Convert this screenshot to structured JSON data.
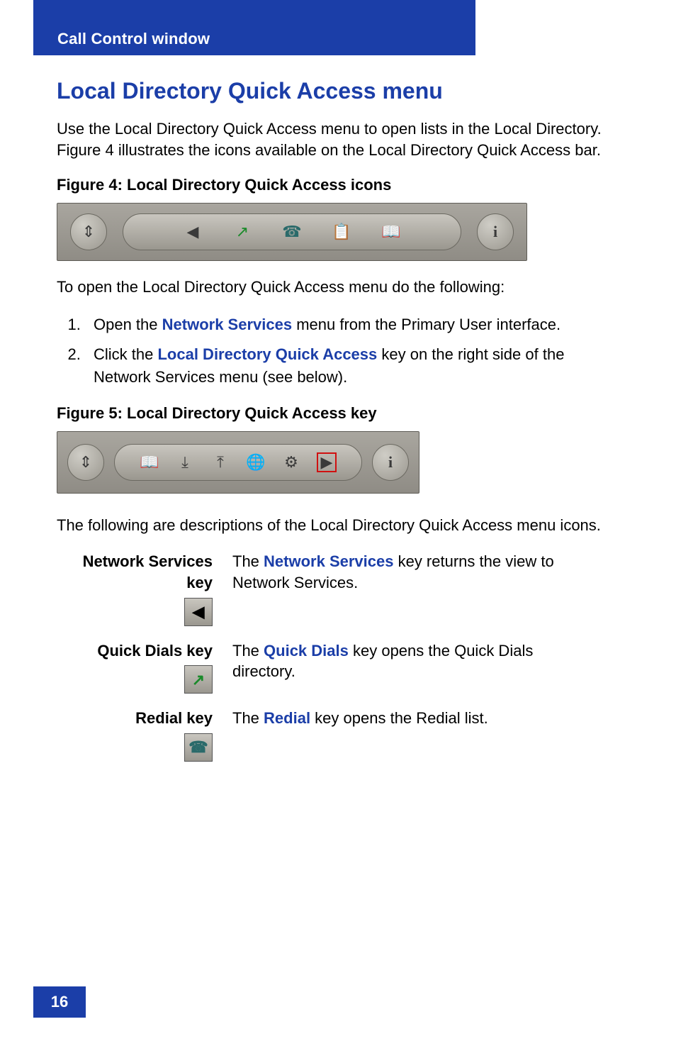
{
  "header": {
    "title": "Call Control window"
  },
  "h1": "Local Directory Quick Access menu",
  "intro": "Use the Local Directory Quick Access menu to open lists in the Local Directory. Figure 4 illustrates the icons available on the Local Directory Quick Access bar.",
  "fig4_caption": "Figure 4: Local Directory Quick Access icons",
  "fig4_icons": {
    "updown": "⇕",
    "back": "◀",
    "quickdials": "↗",
    "redial": "☎",
    "callers": "📋",
    "book": "📖",
    "info": "i"
  },
  "steps_intro": "To open the Local Directory Quick Access menu do the following:",
  "steps": [
    {
      "pre": "Open the ",
      "link": "Network Services",
      "post": " menu from the Primary User interface."
    },
    {
      "pre": "Click the ",
      "link": "Local Directory Quick Access",
      "post": " key on the right side of the Network Services menu (see below)."
    }
  ],
  "fig5_caption": "Figure 5: Local Directory Quick Access key",
  "fig5_icons": {
    "updown": "⇕",
    "book": "📖",
    "in": "⤓",
    "out": "⤒",
    "globe": "🌐",
    "node": "⚙",
    "play": "▶",
    "info": "i"
  },
  "desc_intro": "The following are descriptions of the Local Directory Quick Access menu icons.",
  "table": [
    {
      "label": "Network Services key",
      "icon": "◀",
      "desc_pre": "The ",
      "desc_link": "Network Services",
      "desc_post": " key returns the view to Network Services."
    },
    {
      "label": "Quick Dials key",
      "icon": "↗",
      "desc_pre": "The ",
      "desc_link": "Quick Dials",
      "desc_post": " key opens the Quick Dials directory."
    },
    {
      "label": "Redial key",
      "icon": "☎",
      "desc_pre": "The ",
      "desc_link": "Redial",
      "desc_post": " key opens the Redial list."
    }
  ],
  "page_number": "16"
}
